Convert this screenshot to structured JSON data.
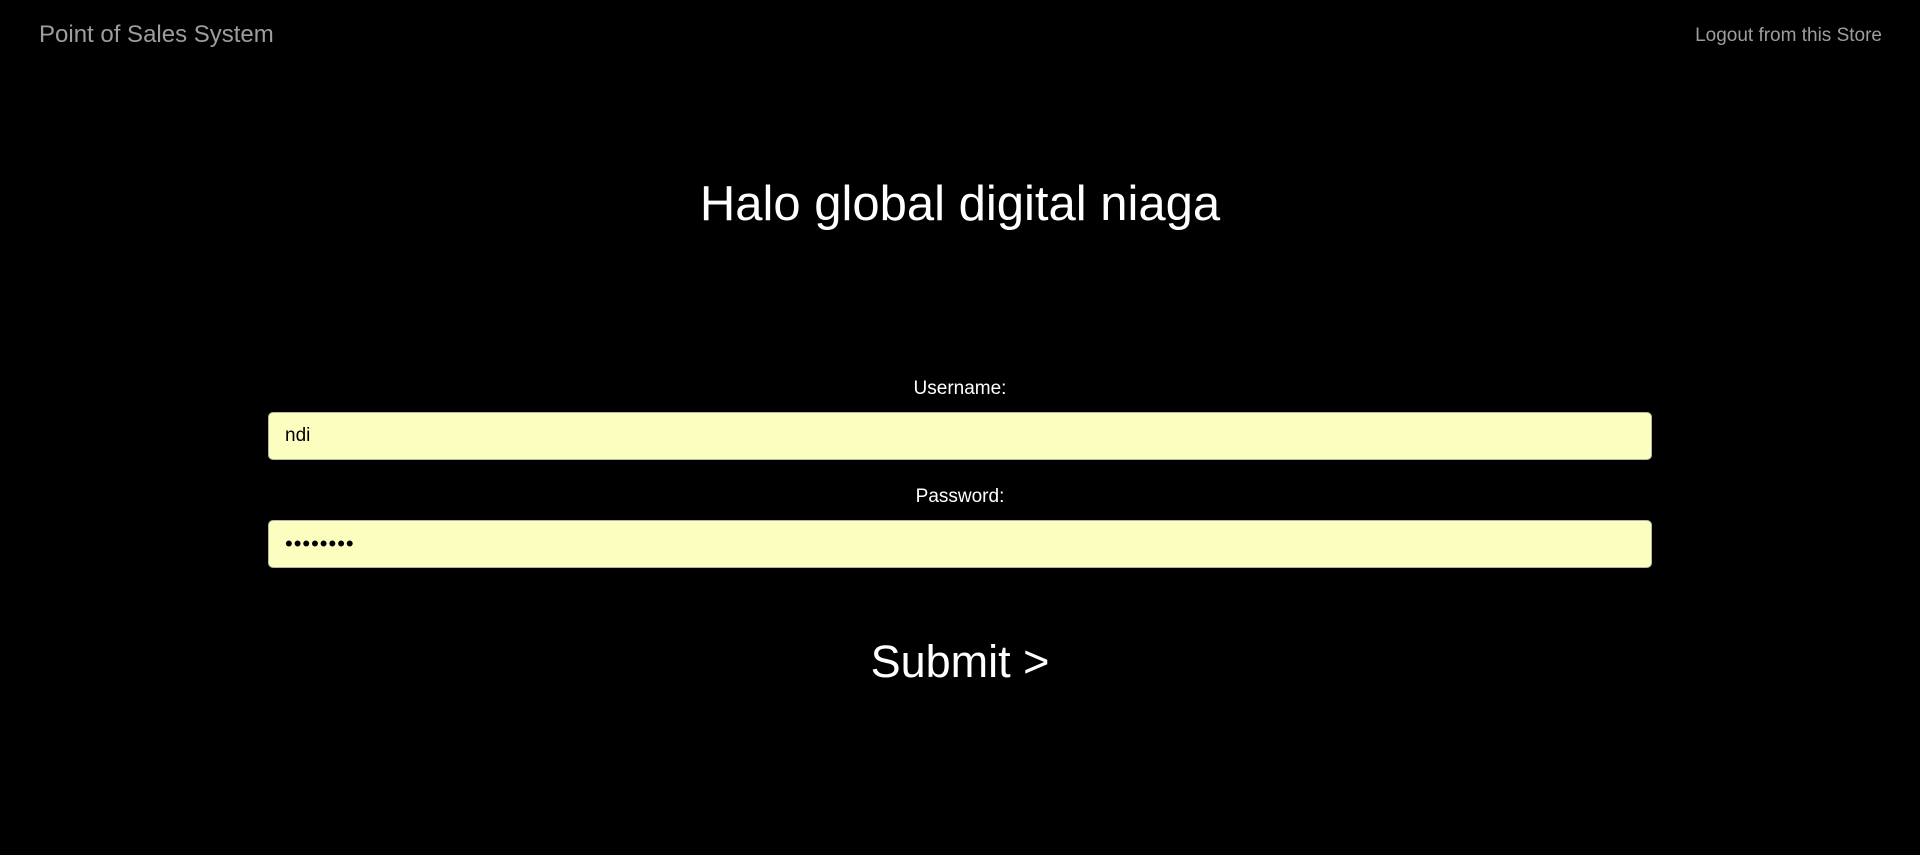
{
  "navbar": {
    "brand": "Point of Sales System",
    "logout": "Logout from this Store"
  },
  "main": {
    "store_title": "Halo global digital niaga"
  },
  "form": {
    "username_label": "Username:",
    "username_value": "ndi",
    "password_label": "Password:",
    "password_value": "********",
    "submit_label": "Submit >"
  },
  "colors": {
    "background": "#000000",
    "nav_text": "#9d9d9d",
    "input_background": "#fcfebf",
    "text": "#ffffff"
  }
}
